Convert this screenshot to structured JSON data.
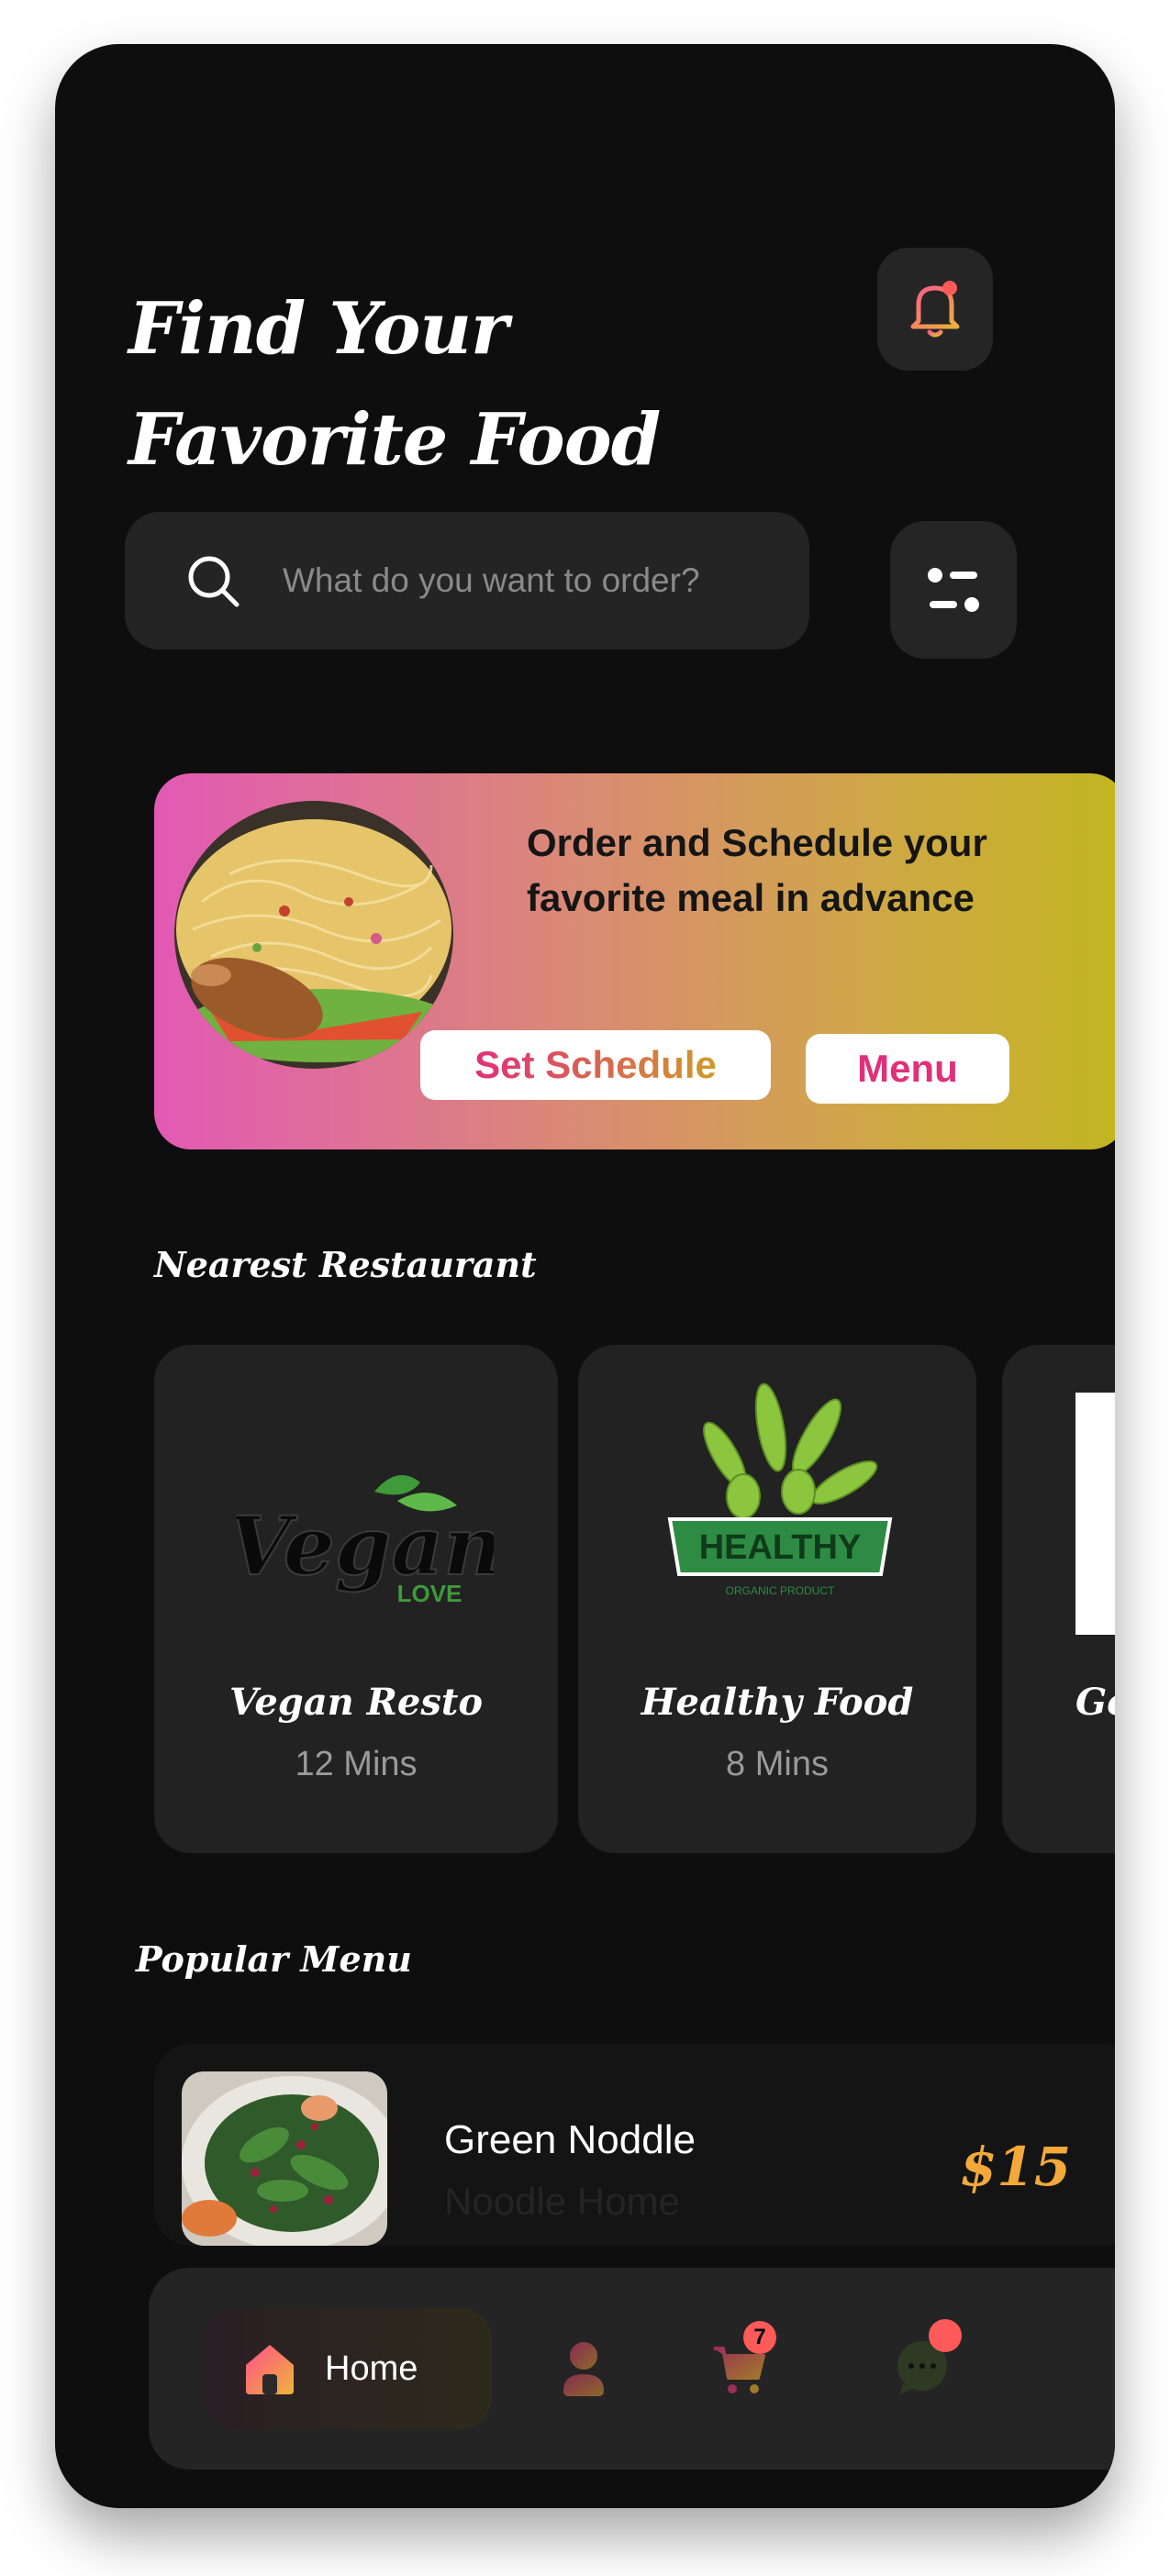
{
  "header": {
    "title_line1": "Find Your",
    "title_line2": "Favorite Food",
    "bell_icon": "bell-icon"
  },
  "search": {
    "placeholder": "What do you want to order?",
    "icon": "search-icon",
    "filter_icon": "filter-icon"
  },
  "promo": {
    "text": "Order and Schedule your favorite meal in advance",
    "schedule_label": "Set Schedule",
    "menu_label": "Menu",
    "image": "noodle-dish-image"
  },
  "nearest": {
    "section_title": "Nearest Restaurant",
    "restaurants": [
      {
        "name": "Vegan Resto",
        "time": "12 Mins",
        "logo_text": "Vegan",
        "logo_sub": "LOVE"
      },
      {
        "name": "Healthy Food",
        "time": "8 Mins",
        "logo_text": "HEALTHY",
        "logo_sub": "ORGANIC PRODUCT"
      },
      {
        "name": "Go",
        "time": ""
      }
    ]
  },
  "popular": {
    "section_title": "Popular Menu",
    "items": [
      {
        "name": "Green Noddle",
        "restaurant": "Noodle Home",
        "price": "$15"
      }
    ]
  },
  "bottom_nav": {
    "home_label": "Home",
    "cart_badge": "7",
    "icons": [
      "home-icon",
      "profile-icon",
      "cart-icon",
      "chat-icon"
    ]
  },
  "colors": {
    "background": "#0e0e0e",
    "card": "#222222",
    "accent_pink": "#e0307a",
    "accent_yellow": "#f3a93a",
    "badge_red": "#ff5a5a"
  }
}
